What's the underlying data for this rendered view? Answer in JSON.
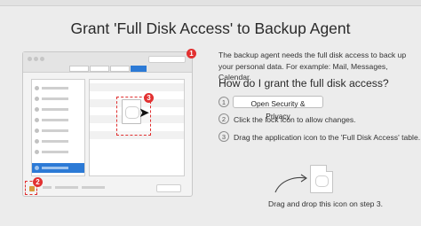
{
  "title": "Grant 'Full Disk Access' to Backup Agent",
  "description": "The backup agent needs the full disk access to back up your personal data. For example: Mail, Messages, Calendar.",
  "how_to_heading": "How do I grant the full disk access?",
  "steps": [
    {
      "number": "1",
      "button_label": "Open Security & Privacy"
    },
    {
      "number": "2",
      "text": "Click the lock icon to allow changes."
    },
    {
      "number": "3",
      "text": "Drag the application icon to the 'Full Disk Access' table."
    }
  ],
  "drag_caption": "Drag and drop this icon on step 3.",
  "illustration": {
    "badges": [
      "1",
      "2",
      "3"
    ],
    "cursor_icon": "arrow-cursor-icon",
    "lock_icon": "lock-icon",
    "document_icon": "app-document-icon"
  },
  "colors": {
    "accent": "#2c7ad6",
    "badge": "#e23131",
    "highlight_border": "#e03030"
  }
}
